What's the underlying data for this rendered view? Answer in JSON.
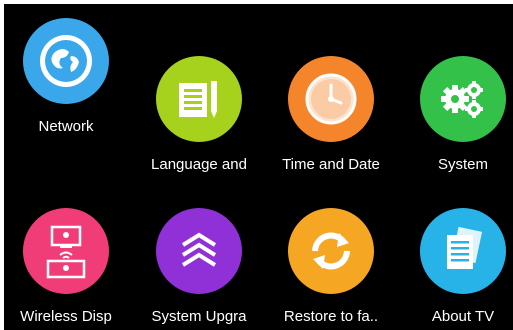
{
  "tiles": [
    {
      "label": "Network",
      "icon": "network-icon",
      "color": "#3aa7ea"
    },
    {
      "label": "Language and",
      "icon": "language-icon",
      "color": "#a6d11d"
    },
    {
      "label": "Time and Date",
      "icon": "clock-icon",
      "color": "#f5852a"
    },
    {
      "label": "System",
      "icon": "gears-icon",
      "color": "#33c14a"
    },
    {
      "label": "Wireless Disp",
      "icon": "wireless-display-icon",
      "color": "#f03d78"
    },
    {
      "label": "System Upgra",
      "icon": "upgrade-icon",
      "color": "#8f31d6"
    },
    {
      "label": "Restore to fa..",
      "icon": "restore-icon",
      "color": "#f5a623"
    },
    {
      "label": "About TV",
      "icon": "document-icon",
      "color": "#27b3e8"
    }
  ]
}
